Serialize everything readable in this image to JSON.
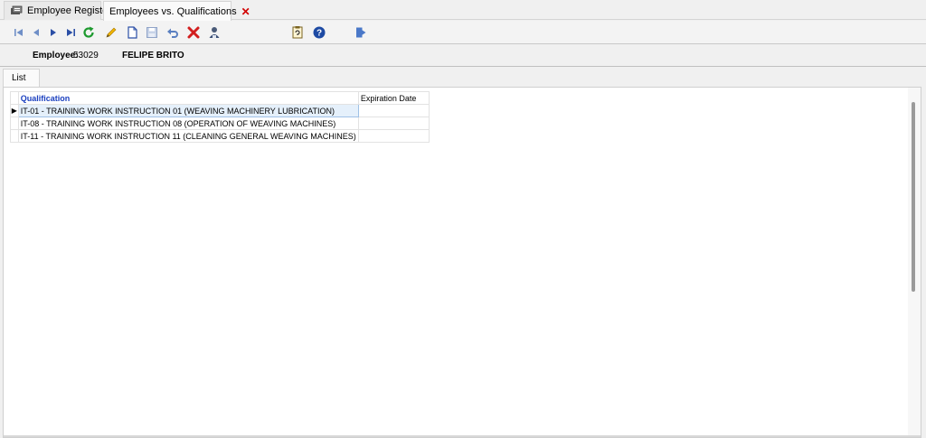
{
  "tabs": [
    {
      "label": "Employee Register",
      "icon": "employee-register-icon"
    },
    {
      "label": "Employees vs. Qualifications",
      "icon": "close-icon"
    }
  ],
  "toolbar": {
    "buttons": [
      "first-record",
      "previous-record",
      "next-record",
      "last-record",
      "refresh",
      "edit",
      "new",
      "save",
      "undo",
      "delete",
      "employee-search",
      "report",
      "help",
      "exit"
    ]
  },
  "employee": {
    "label": "Employee:",
    "number": "53029",
    "name": "FELIPE BRITO"
  },
  "inner_tabs": [
    {
      "label": "List"
    }
  ],
  "grid": {
    "columns": [
      "Qualification",
      "Expiration Date"
    ],
    "rows": [
      {
        "qualification": "IT-01 - TRAINING WORK INSTRUCTION 01 (WEAVING MACHINERY LUBRICATION)",
        "expiration": "",
        "selected": true
      },
      {
        "qualification": "IT-08 - TRAINING WORK INSTRUCTION 08 (OPERATION OF WEAVING MACHINES)",
        "expiration": "",
        "selected": false
      },
      {
        "qualification": "IT-11 - TRAINING WORK INSTRUCTION 11 (CLEANING GENERAL WEAVING MACHINES)",
        "expiration": "",
        "selected": false
      }
    ]
  },
  "colors": {
    "header_accent": "#1a3fbf",
    "selection": "#e5f0fb",
    "close": "#d10000"
  }
}
